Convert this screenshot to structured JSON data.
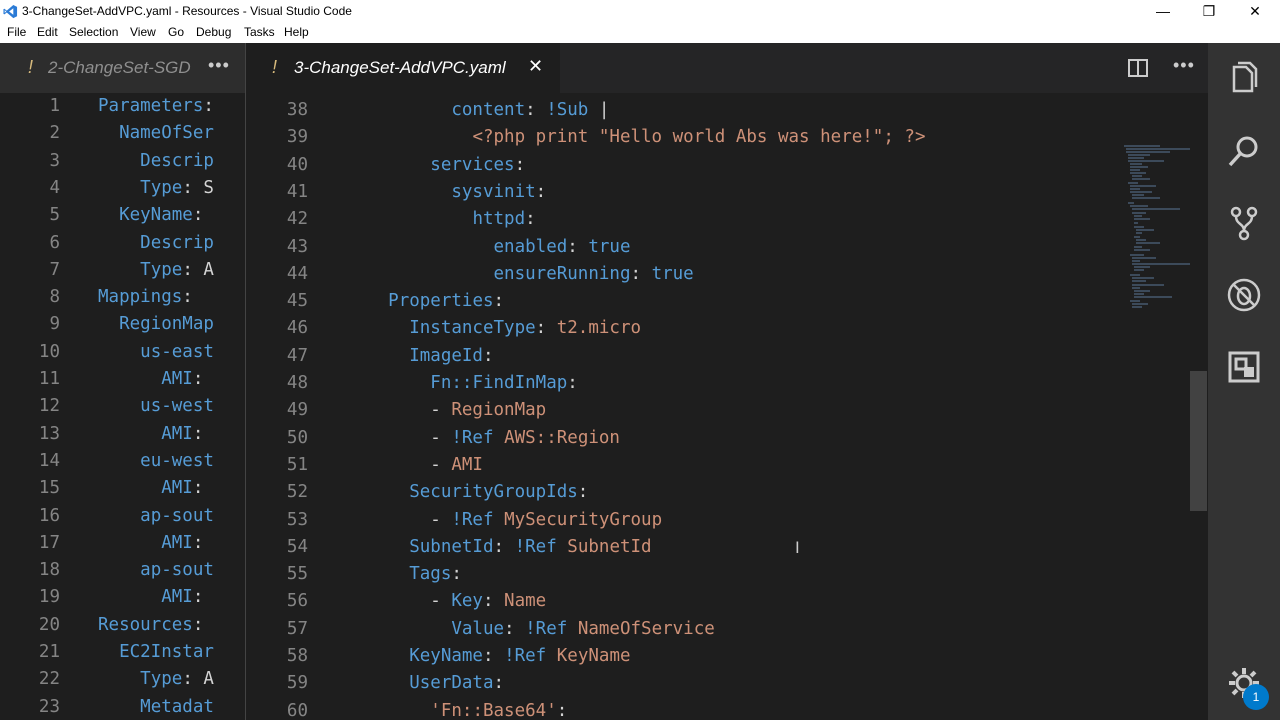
{
  "window": {
    "title": "3-ChangeSet-AddVPC.yaml - Resources - Visual Studio Code",
    "minimize_glyph": "—",
    "restore_glyph": "❐",
    "close_glyph": "✕"
  },
  "menu": [
    "File",
    "Edit",
    "Selection",
    "View",
    "Go",
    "Debug",
    "Tasks",
    "Help"
  ],
  "left_editor": {
    "tab": {
      "modified_marker": "!",
      "label": "2-ChangeSet-SGD",
      "more": "•••"
    },
    "lines": [
      {
        "n": "1",
        "indent": "",
        "key": "Parameters",
        "rest": ":"
      },
      {
        "n": "2",
        "indent": "  ",
        "key": "NameOfSer",
        "rest": ""
      },
      {
        "n": "3",
        "indent": "    ",
        "key": "Descrip",
        "rest": ""
      },
      {
        "n": "4",
        "indent": "    ",
        "key": "Type",
        "rest": ": S"
      },
      {
        "n": "5",
        "indent": "  ",
        "key": "KeyName",
        "rest": ": "
      },
      {
        "n": "6",
        "indent": "    ",
        "key": "Descrip",
        "rest": ""
      },
      {
        "n": "7",
        "indent": "    ",
        "key": "Type",
        "rest": ": A"
      },
      {
        "n": "8",
        "indent": "",
        "key": "Mappings",
        "rest": ":"
      },
      {
        "n": "9",
        "indent": "  ",
        "key": "RegionMap",
        "rest": ""
      },
      {
        "n": "10",
        "indent": "    ",
        "key": "us-east",
        "rest": ""
      },
      {
        "n": "11",
        "indent": "      ",
        "key": "AMI",
        "rest": ":"
      },
      {
        "n": "12",
        "indent": "    ",
        "key": "us-west",
        "rest": ""
      },
      {
        "n": "13",
        "indent": "      ",
        "key": "AMI",
        "rest": ":"
      },
      {
        "n": "14",
        "indent": "    ",
        "key": "eu-west",
        "rest": ""
      },
      {
        "n": "15",
        "indent": "      ",
        "key": "AMI",
        "rest": ":"
      },
      {
        "n": "16",
        "indent": "    ",
        "key": "ap-sout",
        "rest": ""
      },
      {
        "n": "17",
        "indent": "      ",
        "key": "AMI",
        "rest": ":"
      },
      {
        "n": "18",
        "indent": "    ",
        "key": "ap-sout",
        "rest": ""
      },
      {
        "n": "19",
        "indent": "      ",
        "key": "AMI",
        "rest": ":"
      },
      {
        "n": "20",
        "indent": "",
        "key": "Resources",
        "rest": ":"
      },
      {
        "n": "21",
        "indent": "  ",
        "key": "EC2Instar",
        "rest": ""
      },
      {
        "n": "22",
        "indent": "    ",
        "key": "Type",
        "rest": ": A"
      },
      {
        "n": "23",
        "indent": "    ",
        "key": "Metadat",
        "rest": ""
      }
    ]
  },
  "right_editor": {
    "tab": {
      "modified_marker": "!",
      "label": "3-ChangeSet-AddVPC.yaml",
      "close": "✕",
      "more": "•••"
    },
    "lines": [
      {
        "n": "38",
        "parts": [
          [
            "p",
            "          "
          ],
          [
            "k",
            "content"
          ],
          [
            "p",
            ": "
          ],
          [
            "k",
            "!Sub"
          ],
          [
            "p",
            " |"
          ]
        ]
      },
      {
        "n": "39",
        "parts": [
          [
            "p",
            "            "
          ],
          [
            "s",
            "<?php print \"Hello world Abs was here!\"; ?>"
          ]
        ]
      },
      {
        "n": "40",
        "parts": [
          [
            "p",
            "        "
          ],
          [
            "k",
            "services"
          ],
          [
            "p",
            ":"
          ]
        ]
      },
      {
        "n": "41",
        "parts": [
          [
            "p",
            "          "
          ],
          [
            "k",
            "sysvinit"
          ],
          [
            "p",
            ":"
          ]
        ]
      },
      {
        "n": "42",
        "parts": [
          [
            "p",
            "            "
          ],
          [
            "k",
            "httpd"
          ],
          [
            "p",
            ":"
          ]
        ]
      },
      {
        "n": "43",
        "parts": [
          [
            "p",
            "              "
          ],
          [
            "k",
            "enabled"
          ],
          [
            "p",
            ": "
          ],
          [
            "k",
            "true"
          ]
        ]
      },
      {
        "n": "44",
        "parts": [
          [
            "p",
            "              "
          ],
          [
            "k",
            "ensureRunning"
          ],
          [
            "p",
            ": "
          ],
          [
            "k",
            "true"
          ]
        ]
      },
      {
        "n": "45",
        "parts": [
          [
            "p",
            "    "
          ],
          [
            "k",
            "Properties"
          ],
          [
            "p",
            ":"
          ]
        ]
      },
      {
        "n": "46",
        "parts": [
          [
            "p",
            "      "
          ],
          [
            "k",
            "InstanceType"
          ],
          [
            "p",
            ": "
          ],
          [
            "s",
            "t2.micro"
          ]
        ]
      },
      {
        "n": "47",
        "parts": [
          [
            "p",
            "      "
          ],
          [
            "k",
            "ImageId"
          ],
          [
            "p",
            ":"
          ]
        ]
      },
      {
        "n": "48",
        "parts": [
          [
            "p",
            "        "
          ],
          [
            "k",
            "Fn::FindInMap"
          ],
          [
            "p",
            ":"
          ]
        ]
      },
      {
        "n": "49",
        "parts": [
          [
            "p",
            "        - "
          ],
          [
            "s",
            "RegionMap"
          ]
        ]
      },
      {
        "n": "50",
        "parts": [
          [
            "p",
            "        - "
          ],
          [
            "k",
            "!Ref"
          ],
          [
            "p",
            " "
          ],
          [
            "s",
            "AWS::Region"
          ]
        ]
      },
      {
        "n": "51",
        "parts": [
          [
            "p",
            "        - "
          ],
          [
            "s",
            "AMI"
          ]
        ]
      },
      {
        "n": "52",
        "parts": [
          [
            "p",
            "      "
          ],
          [
            "k",
            "SecurityGroupIds"
          ],
          [
            "p",
            ":"
          ]
        ]
      },
      {
        "n": "53",
        "parts": [
          [
            "p",
            "        - "
          ],
          [
            "k",
            "!Ref"
          ],
          [
            "p",
            " "
          ],
          [
            "s",
            "MySecurityGroup"
          ]
        ]
      },
      {
        "n": "54",
        "parts": [
          [
            "p",
            "      "
          ],
          [
            "k",
            "SubnetId"
          ],
          [
            "p",
            ": "
          ],
          [
            "k",
            "!Ref"
          ],
          [
            "p",
            " "
          ],
          [
            "s",
            "SubnetId"
          ]
        ]
      },
      {
        "n": "55",
        "parts": [
          [
            "p",
            "      "
          ],
          [
            "k",
            "Tags"
          ],
          [
            "p",
            ":"
          ]
        ]
      },
      {
        "n": "56",
        "parts": [
          [
            "p",
            "        - "
          ],
          [
            "k",
            "Key"
          ],
          [
            "p",
            ": "
          ],
          [
            "s",
            "Name"
          ]
        ]
      },
      {
        "n": "57",
        "parts": [
          [
            "p",
            "          "
          ],
          [
            "k",
            "Value"
          ],
          [
            "p",
            ": "
          ],
          [
            "k",
            "!Ref"
          ],
          [
            "p",
            " "
          ],
          [
            "s",
            "NameOfService"
          ]
        ]
      },
      {
        "n": "58",
        "parts": [
          [
            "p",
            "      "
          ],
          [
            "k",
            "KeyName"
          ],
          [
            "p",
            ": "
          ],
          [
            "k",
            "!Ref"
          ],
          [
            "p",
            " "
          ],
          [
            "s",
            "KeyName"
          ]
        ]
      },
      {
        "n": "59",
        "parts": [
          [
            "p",
            "      "
          ],
          [
            "k",
            "UserData"
          ],
          [
            "p",
            ":"
          ]
        ]
      },
      {
        "n": "60",
        "parts": [
          [
            "p",
            "        "
          ],
          [
            "s",
            "'Fn::Base64'"
          ],
          [
            "p",
            ":"
          ]
        ]
      }
    ]
  },
  "activity_bar": {
    "items": [
      "explorer-icon",
      "search-icon",
      "source-control-icon",
      "debug-icon",
      "extensions-icon"
    ],
    "settings_badge": "1"
  },
  "colors": {
    "keyword": "#569cd6",
    "string": "#ce9178",
    "punctuation": "#d4d4d4",
    "editor_bg": "#1e1e1e",
    "activity_bg": "#333333",
    "badge": "#007acc"
  }
}
